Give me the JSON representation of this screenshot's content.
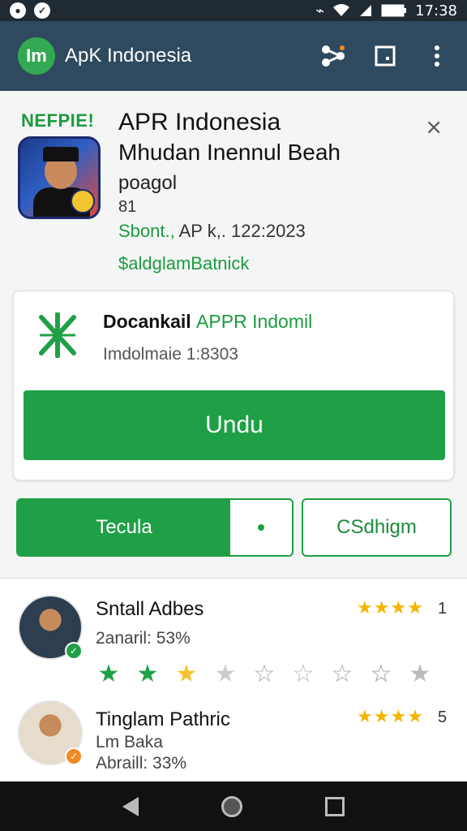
{
  "status_bar": {
    "time": "17:38",
    "left_icons": [
      "app-notification-icon",
      "app-notification-icon"
    ],
    "right_icons": [
      "vibrate-icon",
      "wifi-icon",
      "signal-icon",
      "battery-icon"
    ]
  },
  "app_bar": {
    "logo_text": "Im",
    "title": "ApK Indonesia",
    "actions": [
      "share-icon",
      "bookmark-icon",
      "more-vert-icon"
    ]
  },
  "header": {
    "badge": "NEFPIE!",
    "title": "APR Indonesia",
    "subtitle": "Mhudan Inennul Beah",
    "developer": "poagol",
    "number": "81",
    "meta_green": "Sbont.,",
    "meta_rest": "AP k,. 122:2023",
    "category": "$aldglamBatnick",
    "close": "×"
  },
  "download_card": {
    "title_bold": "Docankail",
    "title_green": "APPR Indomil",
    "version": "Imdolmaie 1:8303",
    "button_label": "Undu"
  },
  "buttons": {
    "primary_label": "Tecula",
    "secondary_label": "CSdhigm"
  },
  "reviews": [
    {
      "name": "Sntall Adbes",
      "line1": "2anaril: 53%",
      "stars": "★★★★",
      "count": "1",
      "rating_row": [
        "★",
        "★",
        "★",
        "★",
        "☆",
        "☆",
        "☆",
        "☆",
        "★"
      ]
    },
    {
      "name": "Tinglam Pathric",
      "line1": "Lm Baka",
      "line2": "Abraill: 33%",
      "stars": "★★★★",
      "count": "5"
    }
  ],
  "colors": {
    "accent": "#1fa046",
    "app_bar": "#2f4a5e",
    "status_bar": "#1f2a33",
    "star": "#f4b400"
  }
}
